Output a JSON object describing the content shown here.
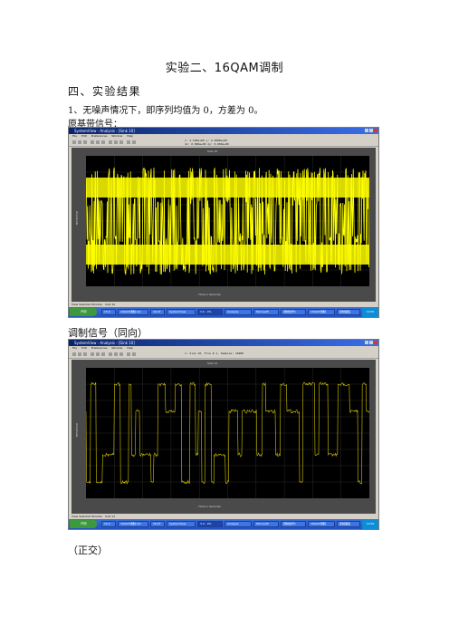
{
  "doc": {
    "title": "实验二、16QAM调制",
    "section_heading": "四、实验结果",
    "item1_text": "1、无噪声情况下，即序列均值为 0，方差为 0。",
    "label_baseband": "原基带信号：",
    "label_modulated_inphase": "调制信号（同向）",
    "label_quadrature": "（正交）"
  },
  "screenshot1": {
    "window_title": "SystemView - Analysis - [Sink 10]",
    "menu": [
      "File",
      "Edit",
      "Preferences",
      "Window",
      "Help"
    ],
    "readout": [
      "x: 2.528e+00   y: 2.4000e+00",
      "dx: 0.000e+00   dy: 0.000e+00"
    ],
    "plot_title": "Sink 10",
    "x_label": "Time in Seconds",
    "y_label": "Amplitude",
    "status": [
      "View Selected Window",
      "Sink 10",
      "Analysis"
    ],
    "taskbar": [
      "开始",
      "15.0",
      "16QAM调制.doc",
      "16.07",
      "SystemView",
      "3.0 - 0%",
      "Analysis",
      "Microsoft",
      "调制信号1",
      "16QAM调制",
      "控制面板"
    ],
    "clock": "19:05",
    "trace_color": "#ffff00",
    "plot_bg": "#000000"
  },
  "screenshot2": {
    "window_title": "SystemView - Analysis - [Sink 10]",
    "menu": [
      "File",
      "Edit",
      "Preferences",
      "Window",
      "Help"
    ],
    "readout": [
      "x: Sink 10, File # 1, Samples: 16000"
    ],
    "plot_title": "Sink 11",
    "x_label": "Time in Seconds",
    "y_label": "Amplitude",
    "status": [
      "View Selected Window",
      "Sink 11",
      "Analysis"
    ],
    "taskbar": [
      "开始",
      "15.0",
      "16QAM调制.doc",
      "16.07",
      "SystemView",
      "3.0 - 0%",
      "Analysis",
      "Microsoft",
      "调制信号1",
      "16QAM调制",
      "控制面板"
    ],
    "clock": "19:06",
    "trace_color": "#d4c400",
    "plot_bg": "#000000"
  }
}
